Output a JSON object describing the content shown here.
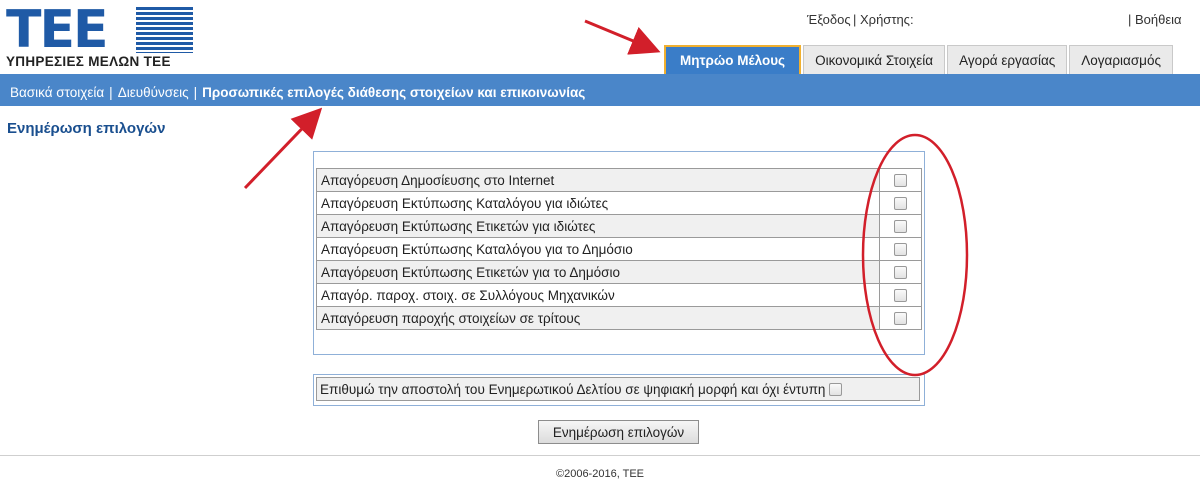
{
  "logo": {
    "letters": "ΤΕΕ",
    "subtitle": "ΥΠΗΡΕΣΙΕΣ ΜΕΛΩΝ ΤΕΕ"
  },
  "header": {
    "logout": "Έξοδος",
    "pipe": "|",
    "user_label": "Χρήστης:",
    "help": "| Βοήθεια"
  },
  "tabs": [
    {
      "label": "Μητρώο Μέλους",
      "active": true
    },
    {
      "label": "Οικονομικά Στοιχεία"
    },
    {
      "label": "Αγορά εργασίας"
    },
    {
      "label": "Λογαριασμός"
    }
  ],
  "subnav": {
    "basic": "Βασικά στοιχεία",
    "addresses": "Διευθύνσεις",
    "personal": "Προσωπικές επιλογές διάθεσης στοιχείων και επικοινωνίας",
    "separator": "|"
  },
  "section_title": "Ενημέρωση επιλογών",
  "options": [
    {
      "label": "Απαγόρευση Δημοσίευσης στο Internet",
      "checked": false
    },
    {
      "label": "Απαγόρευση Εκτύπωσης Καταλόγου για ιδιώτες",
      "checked": false
    },
    {
      "label": "Απαγόρευση Εκτύπωσης Ετικετών για ιδιώτες",
      "checked": false
    },
    {
      "label": "Απαγόρευση Εκτύπωσης Καταλόγου για το Δημόσιο",
      "checked": false
    },
    {
      "label": "Απαγόρευση Εκτύπωσης Ετικετών για το Δημόσιο",
      "checked": false
    },
    {
      "label": "Απαγόρ. παροχ. στοιχ. σε Συλλόγους Μηχανικών",
      "checked": false
    },
    {
      "label": "Απαγόρευση παροχής στοιχείων σε τρίτους",
      "checked": false
    }
  ],
  "newsletter": {
    "label": "Επιθυμώ την αποστολή του Ενημερωτικού Δελτίου σε ψηφιακή μορφή και όχι έντυπη",
    "checked": false
  },
  "submit_button": "Ενημέρωση επιλογών",
  "footer": {
    "copyright": "©2006-2016, ΤΕΕ"
  },
  "colors": {
    "accent_blue": "#4a86c9",
    "active_tab": "#3a7dc8",
    "tab_outline": "#f0b030",
    "logo_blue": "#1f5aa6",
    "annotation_red": "#d21f2a"
  }
}
